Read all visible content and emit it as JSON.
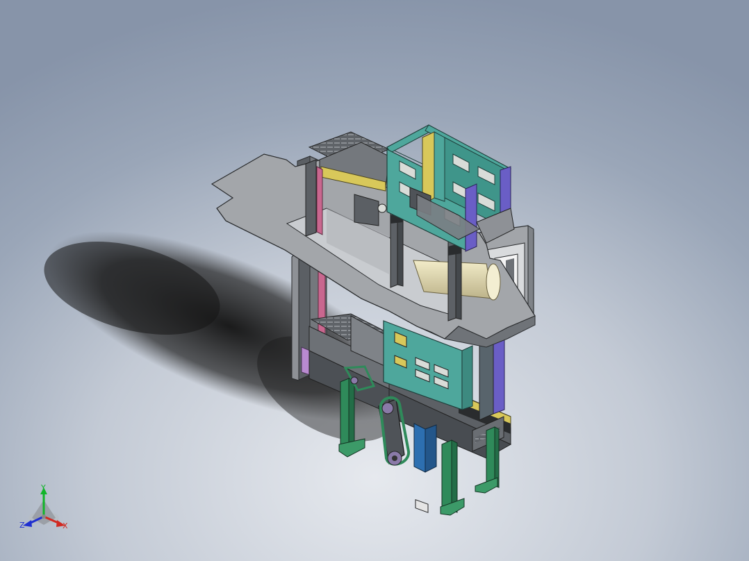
{
  "triad": {
    "y_label": "Y",
    "z_label": "Z",
    "x_label": "X",
    "colors": {
      "y": "#12b52a",
      "x": "#d12a22",
      "z": "#1f2fd0"
    }
  },
  "model": {
    "colors": {
      "plate": "#9fa2a6",
      "frame": "#55595e",
      "teal_frame": "#4ea79c",
      "purple_rail": "#6a5ec6",
      "pink_rail": "#c9678f",
      "green_leg": "#2f8a5a",
      "tray": "#6d7176",
      "roller": "#e6ddb4",
      "yellow_rail": "#d8c85a"
    }
  }
}
